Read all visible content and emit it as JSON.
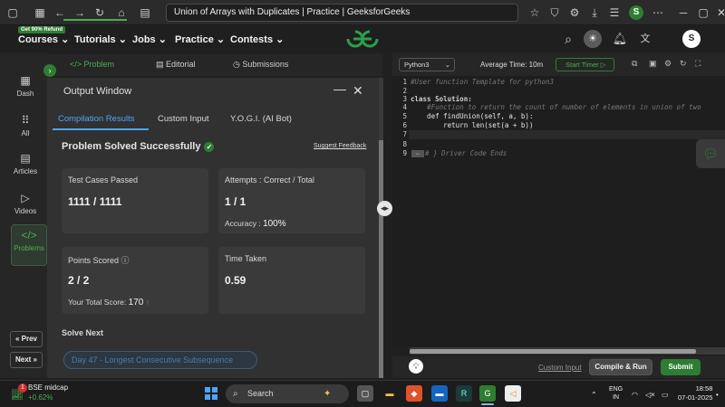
{
  "browser": {
    "tab_title": "Union of Arrays with Duplicates | Practice | GeeksforGeeks",
    "profile_initial": "S"
  },
  "site_header": {
    "refund_badge": "Get 90% Refund",
    "nav": [
      "Courses",
      "Tutorials",
      "Jobs",
      "Practice",
      "Contests"
    ],
    "avatar_initial": "S"
  },
  "left_sidebar": {
    "items": [
      {
        "label": "Dash",
        "icon": "dashboard-icon"
      },
      {
        "label": "All",
        "icon": "grid-icon"
      },
      {
        "label": "Articles",
        "icon": "article-icon"
      },
      {
        "label": "Videos",
        "icon": "video-icon"
      },
      {
        "label": "Problems",
        "icon": "code-icon"
      }
    ],
    "prev_label": "Prev",
    "next_label": "Next"
  },
  "problem_tabs": [
    "Problem",
    "Editorial",
    "Submissions"
  ],
  "output_window": {
    "title": "Output Window",
    "tabs": [
      "Compilation Results",
      "Custom Input",
      "Y.O.G.I. (AI Bot)"
    ],
    "status": "Problem Solved Successfully",
    "suggest_feedback": "Suggest Feedback",
    "cards": {
      "tests": {
        "title": "Test Cases Passed",
        "value": "1111 / 1111"
      },
      "attempts": {
        "title": "Attempts : Correct / Total",
        "value": "1 / 1",
        "sub_label": "Accuracy :",
        "sub_value": "100%"
      },
      "points": {
        "title": "Points Scored",
        "value": "2 / 2",
        "sub_label": "Your Total Score:",
        "sub_value": "170"
      },
      "time": {
        "title": "Time Taken",
        "value": "0.59"
      }
    },
    "solve_next": "Solve Next",
    "next_problem": "Day 47 - Longest Consecutive Subsequence"
  },
  "editor": {
    "language": "Python3",
    "avg_time": "Average Time: 10m",
    "start_timer": "Start Timer",
    "lines": [
      {
        "n": "1",
        "text": "#User function Template for python3"
      },
      {
        "n": "2",
        "text": ""
      },
      {
        "n": "3",
        "text": "class Solution:"
      },
      {
        "n": "4",
        "text": "    #Function to return the count of number of elements in union of two"
      },
      {
        "n": "5",
        "text": "    def findUnion(self, a, b):"
      },
      {
        "n": "6",
        "text": "        return len(set(a + b))"
      },
      {
        "n": "7",
        "text": ""
      },
      {
        "n": "8",
        "text": ""
      },
      {
        "n": "9",
        "text": "# } Driver Code Ends"
      }
    ],
    "custom_input": "Custom Input",
    "compile_run": "Compile & Run",
    "submit": "Submit"
  },
  "taskbar": {
    "stock_name": "BSE midcap",
    "stock_change": "+0.62%",
    "stock_badge": "1",
    "search_placeholder": "Search",
    "lang_line1": "ENG",
    "lang_line2": "IN",
    "time": "18:58",
    "date": "07-01-2025"
  },
  "colors": {
    "accent_green": "#2e7d32",
    "link_blue": "#4fa3f7"
  }
}
